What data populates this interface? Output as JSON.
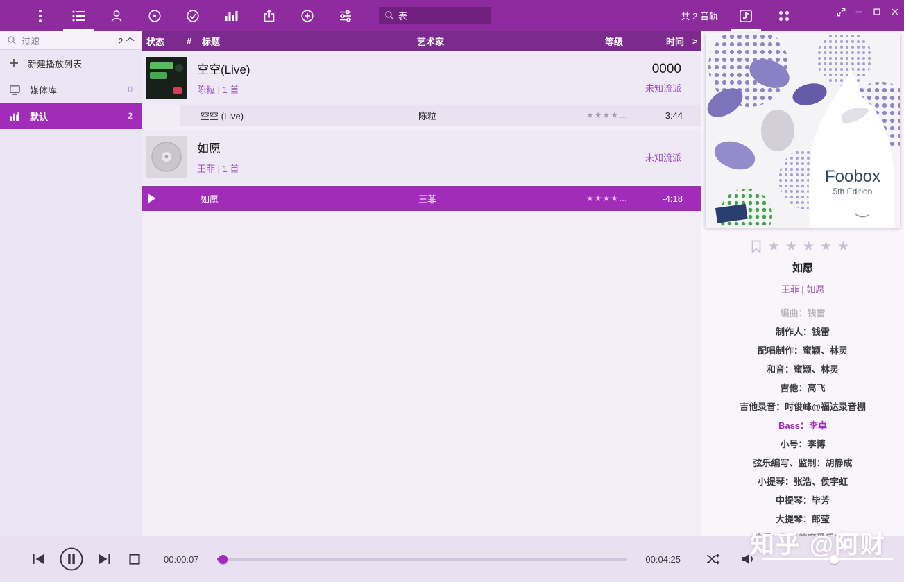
{
  "colors": {
    "accent": "#a22cba",
    "topbar": "#8e2b9e",
    "header": "#7d2a8e"
  },
  "titlebar": {
    "search_value": "表",
    "track_count": "共 2 音轨"
  },
  "sidebar": {
    "filter_label": "过滤",
    "filter_count": "2 个",
    "new_playlist_label": "新建播放列表",
    "items": [
      {
        "label": "媒体库",
        "count": "0"
      },
      {
        "label": "默认",
        "count": "2"
      }
    ]
  },
  "playlist": {
    "header": {
      "status": "状态",
      "num": "#",
      "title": "标题",
      "artist": "艺术家",
      "rating": "等级",
      "time": "时间",
      "more": ">"
    },
    "groups": [
      {
        "title": "空空(Live)",
        "subtitle": "陈粒 | 1 首",
        "code": "0000",
        "genre": "未知流派",
        "tracks": [
          {
            "title": "空空 (Live)",
            "artist": "陈粒",
            "rating": "★★★★…",
            "time": "3:44"
          }
        ]
      },
      {
        "title": "如愿",
        "subtitle": "王菲 | 1 首",
        "code": "",
        "genre": "未知流派",
        "tracks": [
          {
            "title": "如愿",
            "artist": "王菲",
            "rating": "★★★★…",
            "time": "-4:18"
          }
        ]
      }
    ]
  },
  "now_playing": {
    "art_title": "Foobox",
    "art_subtitle": "5th Edition",
    "stars": "★★★★★",
    "title": "如愿",
    "artist_album": "王菲 | 如愿",
    "credits": [
      "编曲：钱雷",
      "制作人：钱雷",
      "配唱制作：蜜颖、林灵",
      "和音：蜜颖、林灵",
      "吉他：高飞",
      "吉他录音：时俊峰@福达录音棚",
      "Bass：李卓",
      "小号：李博",
      "弦乐编写、监制：胡静成",
      "小提琴：张浩、侯宇虹",
      "中提琴：毕芳",
      "大提琴：郎莹",
      "弦乐：国际首席爱乐乐团"
    ]
  },
  "player": {
    "elapsed": "00:00:07",
    "total": "00:04:25",
    "progress_percent": 1.4,
    "volume_percent": 55
  },
  "watermark": "知乎 @阿财"
}
